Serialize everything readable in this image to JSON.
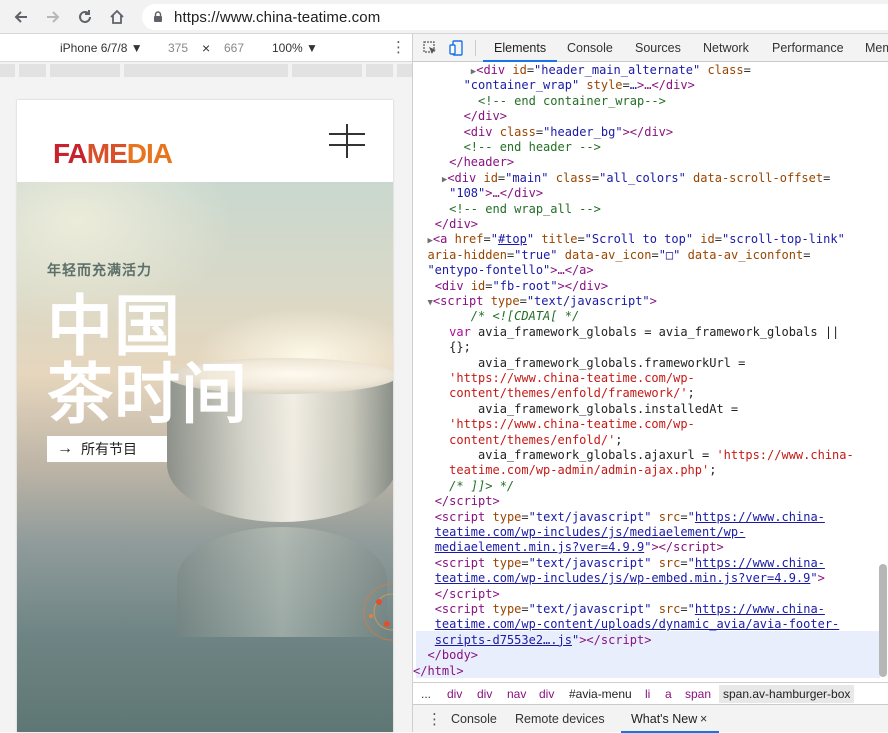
{
  "browser": {
    "url": "https://www.china-teatime.com"
  },
  "device_toolbar": {
    "device": "iPhone 6/7/8",
    "width": "375",
    "times": "×",
    "height": "667",
    "zoom": "100%"
  },
  "site": {
    "logo_text": "FAMEDIA",
    "slogan_small": "年轻而充满活力",
    "slogan_line1": "中国",
    "slogan_line2": "茶时间",
    "cta_arrow": "→",
    "cta_label": "所有节目"
  },
  "devtools": {
    "tabs": [
      "Elements",
      "Console",
      "Sources",
      "Network",
      "Performance",
      "Mem"
    ],
    "active_tab": "Elements",
    "breadcrumbs": [
      "...",
      "div",
      "div",
      "nav",
      "div",
      "#avia-menu",
      "li",
      "a",
      "span",
      "span.av-hamburger-box"
    ],
    "drawer_tabs": [
      "Console",
      "Remote devices",
      "What's New"
    ],
    "drawer_close": "×"
  },
  "colors": {
    "accent": "#1a73e8",
    "logo_red": "#c8232c",
    "logo_orange": "#e8741e"
  }
}
